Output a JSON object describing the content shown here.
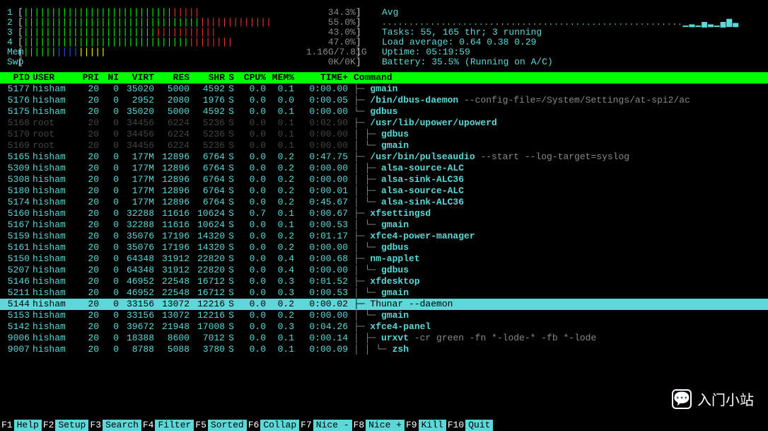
{
  "cpus": [
    {
      "label": "1",
      "bars": "|||||||||||||||||||||||||||",
      "red": "|||||",
      "pct": "34.3%"
    },
    {
      "label": "2",
      "bars": "||||||||||||||||||||||||||||||||",
      "red": "|||||||||||||",
      "pct": "55.0%"
    },
    {
      "label": "3",
      "bars": "||||||||||||||||||||||||",
      "red": "|||||||||||",
      "pct": "43.0%"
    },
    {
      "label": "4",
      "bars": "||||||||||||||||||||||||||||||",
      "red": "||||||||",
      "pct": "47.0%"
    }
  ],
  "mem": {
    "label": "Mem",
    "green": "||||||",
    "blue": "||||",
    "yellow": "|||||",
    "value": "1.16G/7.81G"
  },
  "swp": {
    "label": "Swp",
    "value": "0K/0K"
  },
  "avg_label": "Avg",
  "tasks": "Tasks: 55, 165 thr; 3 running",
  "load": "Load average: 0.64 0.38 0.29",
  "uptime": "Uptime: 05:19:59",
  "battery": "Battery: 35.5% (Running on A/C)",
  "headers": [
    "PID",
    "USER",
    "PRI",
    "NI",
    "VIRT",
    "RES",
    "SHR",
    "S",
    "CPU%",
    "MEM%",
    "TIME+",
    "Command"
  ],
  "processes": [
    {
      "pid": "5177",
      "user": "hisham",
      "pri": "20",
      "ni": "0",
      "virt": "35020",
      "res": "5000",
      "shr": "4592",
      "s": "S",
      "cpu": "0.0",
      "mem": "0.1",
      "time": "0:00.00",
      "tree": "   ├─ ",
      "cmd": "gmain"
    },
    {
      "pid": "5176",
      "user": "hisham",
      "pri": "20",
      "ni": "0",
      "virt": "2952",
      "res": "2080",
      "shr": "1976",
      "s": "S",
      "cpu": "0.0",
      "mem": "0.0",
      "time": "0:00.05",
      "tree": "   ├─ ",
      "cmd": "/bin/dbus-daemon",
      "args": " --config-file=/System/Settings/at-spi2/ac"
    },
    {
      "pid": "5175",
      "user": "hisham",
      "pri": "20",
      "ni": "0",
      "virt": "35020",
      "res": "5000",
      "shr": "4592",
      "s": "S",
      "cpu": "0.0",
      "mem": "0.1",
      "time": "0:00.00",
      "tree": "   └─ ",
      "cmd": "gdbus"
    },
    {
      "pid": "5168",
      "user": "root",
      "pri": "20",
      "ni": "0",
      "virt": "34456",
      "res": "6224",
      "shr": "5236",
      "s": "S",
      "cpu": "0.0",
      "mem": "0.1",
      "time": "0:02.90",
      "tree": "├─ ",
      "cmd": "/usr/lib/upower/upowerd",
      "dimmed": true
    },
    {
      "pid": "5170",
      "user": "root",
      "pri": "20",
      "ni": "0",
      "virt": "34456",
      "res": "6224",
      "shr": "5236",
      "s": "S",
      "cpu": "0.0",
      "mem": "0.1",
      "time": "0:00.00",
      "tree": "│  ├─ ",
      "cmd": "gdbus",
      "dimmed": true
    },
    {
      "pid": "5169",
      "user": "root",
      "pri": "20",
      "ni": "0",
      "virt": "34456",
      "res": "6224",
      "shr": "5236",
      "s": "S",
      "cpu": "0.0",
      "mem": "0.1",
      "time": "0:00.00",
      "tree": "│  └─ ",
      "cmd": "gmain",
      "dimmed": true
    },
    {
      "pid": "5165",
      "user": "hisham",
      "pri": "20",
      "ni": "0",
      "virt": "177M",
      "res": "12896",
      "shr": "6764",
      "s": "S",
      "cpu": "0.0",
      "mem": "0.2",
      "time": "0:47.75",
      "tree": "├─ ",
      "cmd": "/usr/bin/pulseaudio",
      "args": " --start --log-target=syslog"
    },
    {
      "pid": "5309",
      "user": "hisham",
      "pri": "20",
      "ni": "0",
      "virt": "177M",
      "res": "12896",
      "shr": "6764",
      "s": "S",
      "cpu": "0.0",
      "mem": "0.2",
      "time": "0:00.00",
      "tree": "│  ├─ ",
      "cmd": "alsa-source-ALC"
    },
    {
      "pid": "5308",
      "user": "hisham",
      "pri": "20",
      "ni": "0",
      "virt": "177M",
      "res": "12896",
      "shr": "6764",
      "s": "S",
      "cpu": "0.0",
      "mem": "0.2",
      "time": "0:00.00",
      "tree": "│  ├─ ",
      "cmd": "alsa-sink-ALC36"
    },
    {
      "pid": "5180",
      "user": "hisham",
      "pri": "20",
      "ni": "0",
      "virt": "177M",
      "res": "12896",
      "shr": "6764",
      "s": "S",
      "cpu": "0.0",
      "mem": "0.2",
      "time": "0:00.01",
      "tree": "│  ├─ ",
      "cmd": "alsa-source-ALC"
    },
    {
      "pid": "5174",
      "user": "hisham",
      "pri": "20",
      "ni": "0",
      "virt": "177M",
      "res": "12896",
      "shr": "6764",
      "s": "S",
      "cpu": "0.0",
      "mem": "0.2",
      "time": "0:45.67",
      "tree": "│  └─ ",
      "cmd": "alsa-sink-ALC36"
    },
    {
      "pid": "5160",
      "user": "hisham",
      "pri": "20",
      "ni": "0",
      "virt": "32288",
      "res": "11616",
      "shr": "10624",
      "s": "S",
      "cpu": "0.7",
      "mem": "0.1",
      "time": "0:00.67",
      "tree": "├─ ",
      "cmd": "xfsettingsd"
    },
    {
      "pid": "5167",
      "user": "hisham",
      "pri": "20",
      "ni": "0",
      "virt": "32288",
      "res": "11616",
      "shr": "10624",
      "s": "S",
      "cpu": "0.0",
      "mem": "0.1",
      "time": "0:00.53",
      "tree": "│  └─ ",
      "cmd": "gmain"
    },
    {
      "pid": "5159",
      "user": "hisham",
      "pri": "20",
      "ni": "0",
      "virt": "35076",
      "res": "17196",
      "shr": "14320",
      "s": "S",
      "cpu": "0.0",
      "mem": "0.2",
      "time": "0:01.17",
      "tree": "├─ ",
      "cmd": "xfce4-power-manager"
    },
    {
      "pid": "5161",
      "user": "hisham",
      "pri": "20",
      "ni": "0",
      "virt": "35076",
      "res": "17196",
      "shr": "14320",
      "s": "S",
      "cpu": "0.0",
      "mem": "0.2",
      "time": "0:00.00",
      "tree": "│  └─ ",
      "cmd": "gdbus"
    },
    {
      "pid": "5150",
      "user": "hisham",
      "pri": "20",
      "ni": "0",
      "virt": "64348",
      "res": "31912",
      "shr": "22820",
      "s": "S",
      "cpu": "0.0",
      "mem": "0.4",
      "time": "0:00.68",
      "tree": "├─ ",
      "cmd": "nm-applet"
    },
    {
      "pid": "5207",
      "user": "hisham",
      "pri": "20",
      "ni": "0",
      "virt": "64348",
      "res": "31912",
      "shr": "22820",
      "s": "S",
      "cpu": "0.0",
      "mem": "0.4",
      "time": "0:00.00",
      "tree": "│  └─ ",
      "cmd": "gdbus"
    },
    {
      "pid": "5146",
      "user": "hisham",
      "pri": "20",
      "ni": "0",
      "virt": "46952",
      "res": "22548",
      "shr": "16712",
      "s": "S",
      "cpu": "0.0",
      "mem": "0.3",
      "time": "0:01.52",
      "tree": "├─ ",
      "cmd": "xfdesktop"
    },
    {
      "pid": "5211",
      "user": "hisham",
      "pri": "20",
      "ni": "0",
      "virt": "46952",
      "res": "22548",
      "shr": "16712",
      "s": "S",
      "cpu": "0.0",
      "mem": "0.3",
      "time": "0:00.53",
      "tree": "│  └─ ",
      "cmd": "gmain"
    },
    {
      "pid": "5144",
      "user": "hisham",
      "pri": "20",
      "ni": "0",
      "virt": "33156",
      "res": "13072",
      "shr": "12216",
      "s": "S",
      "cpu": "0.0",
      "mem": "0.2",
      "time": "0:00.02",
      "tree": "├─ ",
      "cmd": "Thunar",
      "args": " --daemon",
      "selected": true
    },
    {
      "pid": "5153",
      "user": "hisham",
      "pri": "20",
      "ni": "0",
      "virt": "33156",
      "res": "13072",
      "shr": "12216",
      "s": "S",
      "cpu": "0.0",
      "mem": "0.2",
      "time": "0:00.00",
      "tree": "│  └─ ",
      "cmd": "gmain"
    },
    {
      "pid": "5142",
      "user": "hisham",
      "pri": "20",
      "ni": "0",
      "virt": "39672",
      "res": "21948",
      "shr": "17008",
      "s": "S",
      "cpu": "0.0",
      "mem": "0.3",
      "time": "0:04.26",
      "tree": "├─ ",
      "cmd": "xfce4-panel"
    },
    {
      "pid": "9006",
      "user": "hisham",
      "pri": "20",
      "ni": "0",
      "virt": "18388",
      "res": "8600",
      "shr": "7012",
      "s": "S",
      "cpu": "0.0",
      "mem": "0.1",
      "time": "0:00.14",
      "tree": "│  ├─ ",
      "cmd": "urxvt",
      "args": " -cr green -fn *-lode-* -fb *-lode",
      "partial": true
    },
    {
      "pid": "9007",
      "user": "hisham",
      "pri": "20",
      "ni": "0",
      "virt": "8788",
      "res": "5088",
      "shr": "3780",
      "s": "S",
      "cpu": "0.0",
      "mem": "0.1",
      "time": "0:00.09",
      "tree": "│  │  └─ ",
      "cmd": "zsh"
    }
  ],
  "footer": [
    {
      "k": "F1",
      "l": "Help"
    },
    {
      "k": "F2",
      "l": "Setup"
    },
    {
      "k": "F3",
      "l": "Search"
    },
    {
      "k": "F4",
      "l": "Filter"
    },
    {
      "k": "F5",
      "l": "Sorted"
    },
    {
      "k": "F6",
      "l": "Collap"
    },
    {
      "k": "F7",
      "l": "Nice -"
    },
    {
      "k": "F8",
      "l": "Nice +"
    },
    {
      "k": "F9",
      "l": "Kill"
    },
    {
      "k": "F10",
      "l": "Quit"
    }
  ],
  "watermark": "入门小站"
}
